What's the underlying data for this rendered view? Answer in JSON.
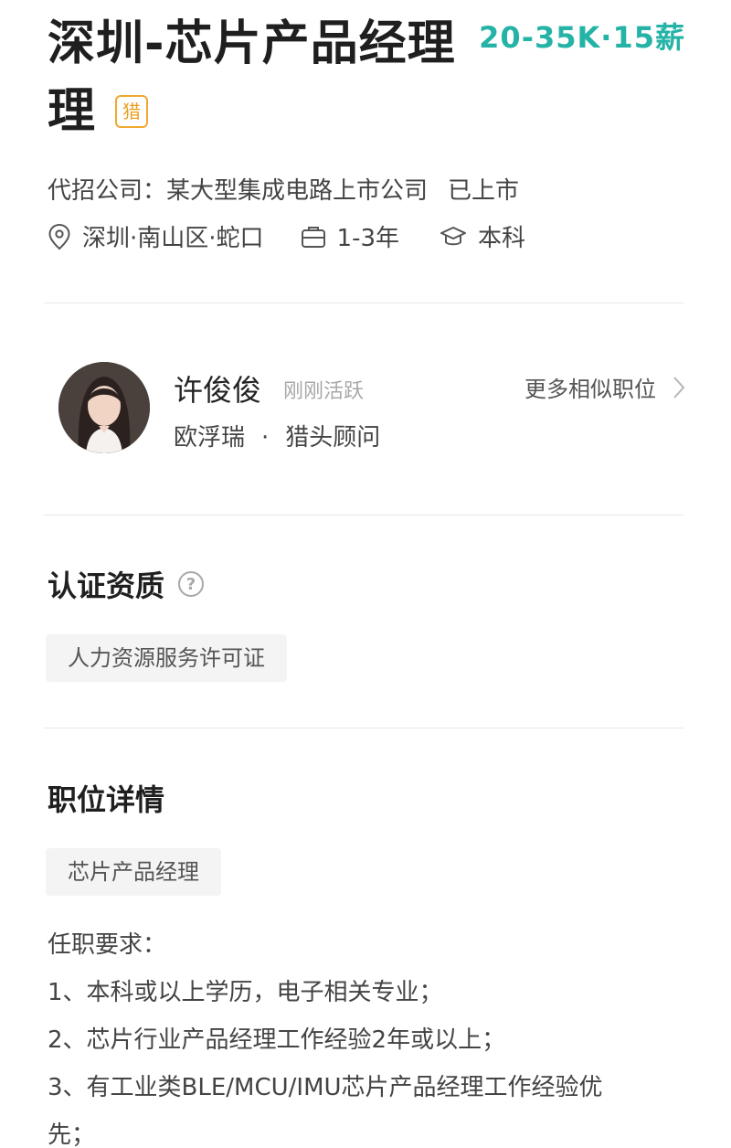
{
  "job": {
    "title_line1": "深圳-芯片产品经理",
    "title_line2": "理",
    "hunter_badge": "猎",
    "salary": "20-35K·15薪",
    "company_label": "代招公司：某大型集成电路上市公司",
    "company_status": "已上市",
    "location": "深圳·南山区·蛇口",
    "experience": "1-3年",
    "education": "本科"
  },
  "recruiter": {
    "name": "许俊俊",
    "active_status": "刚刚活跃",
    "more_similar": "更多相似职位",
    "company": "欧浮瑞",
    "dot": "·",
    "role": "猎头顾问"
  },
  "certification": {
    "title": "认证资质",
    "help_glyph": "?",
    "tag": "人力资源服务许可证"
  },
  "details": {
    "title": "职位详情",
    "tag": "芯片产品经理",
    "requirements": [
      "任职要求：",
      "1、本科或以上学历，电子相关专业；",
      "2、芯片行业产品经理工作经验2年或以上；",
      "3、有工业类BLE/MCU/IMU芯片产品经理工作经验优",
      "先；"
    ]
  },
  "colors": {
    "salary": "#24b3a6",
    "hunter_badge": "#e8a020",
    "tag_bg": "#f4f4f4"
  },
  "icons": {
    "location": "location-pin-icon",
    "experience": "briefcase-icon",
    "education": "graduation-cap-icon",
    "help": "question-circle-icon",
    "more": "chevron-right-icon"
  }
}
